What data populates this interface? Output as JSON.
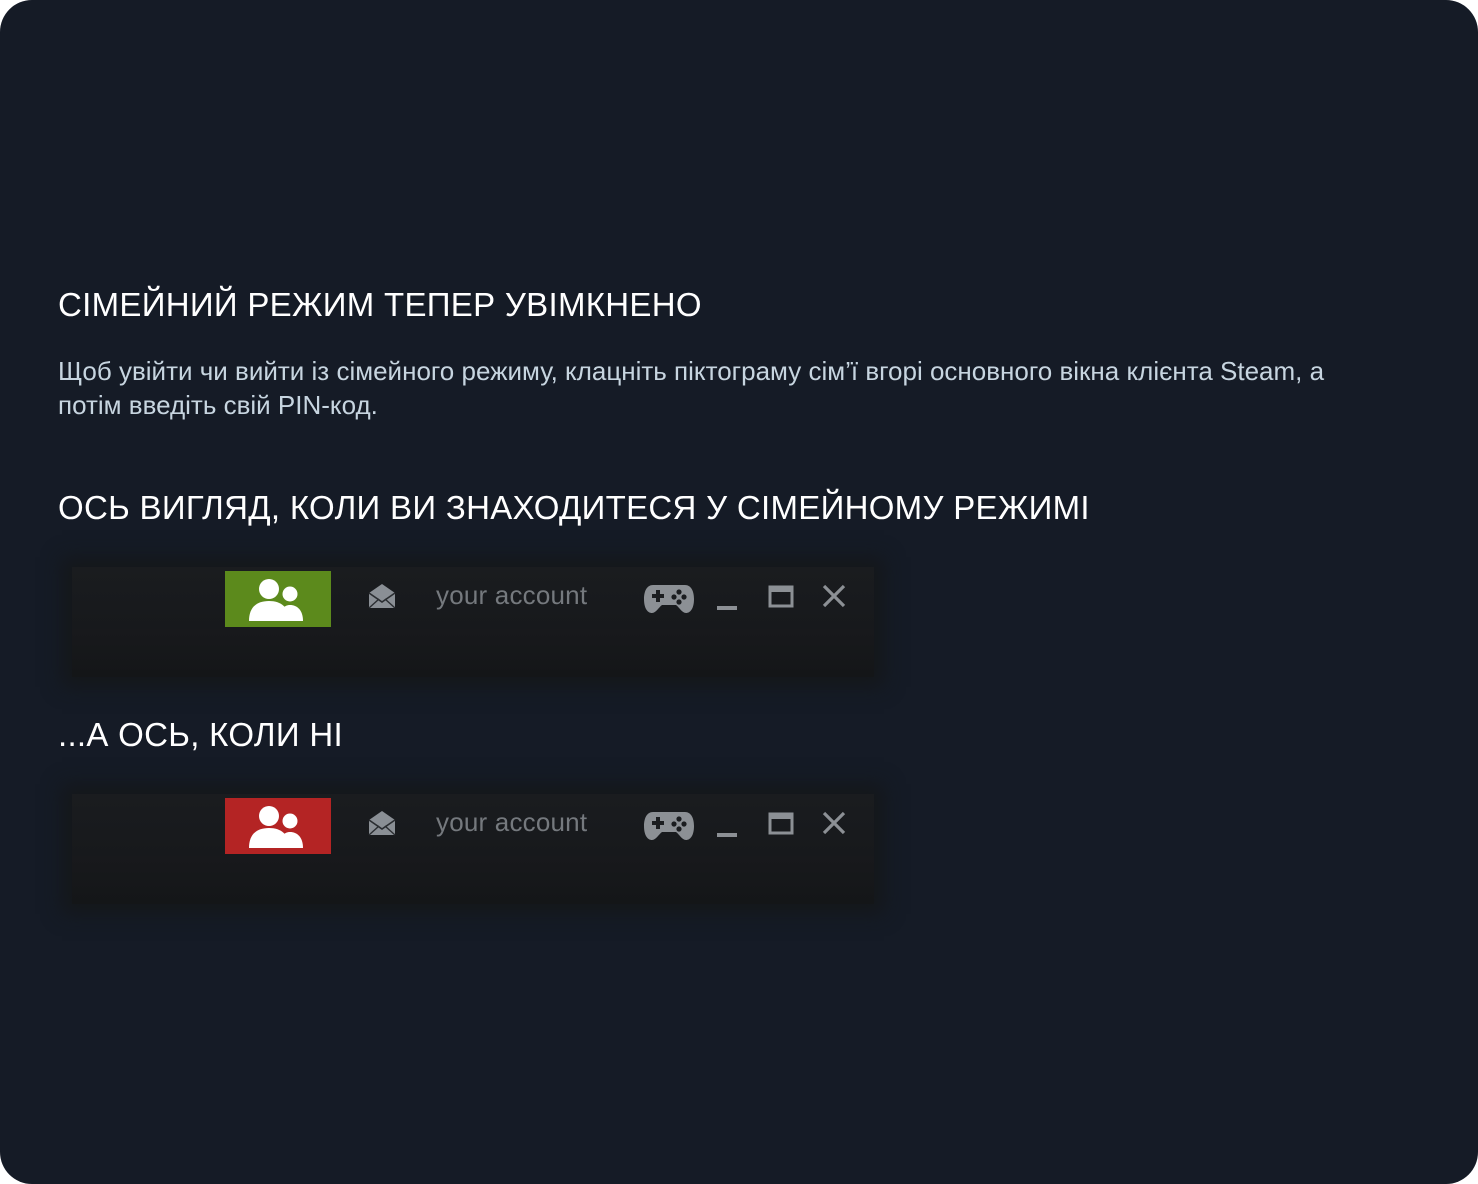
{
  "title": "СІМЕЙНИЙ РЕЖИМ ТЕПЕР УВІМКНЕНО",
  "description": "Щоб увійти чи вийти із сімейного режиму, клацніть піктограму сім’ї вгорі основного вікна клієнта Steam, а потім введіть свій PIN-код.",
  "section_in_family": "ОСЬ ВИГЛЯД, КОЛИ ВИ ЗНАХОДИТЕСЯ У СІМЕЙНОМУ РЕЖИМІ",
  "section_not_family": "...А ОСЬ, КОЛИ НІ",
  "example_in": {
    "family_button_color": "#5c8a1c",
    "family_icon": "family-icon",
    "mail_icon": "envelope-icon",
    "account_label": "your account",
    "controller_icon": "gamepad-icon",
    "window_controls": [
      "minimize-icon",
      "maximize-icon",
      "close-icon"
    ]
  },
  "example_out": {
    "family_button_color": "#b42424",
    "family_icon": "family-icon",
    "mail_icon": "envelope-icon",
    "account_label": "your account",
    "controller_icon": "gamepad-icon",
    "window_controls": [
      "minimize-icon",
      "maximize-icon",
      "close-icon"
    ]
  },
  "colors": {
    "background": "#151b26",
    "heading": "#ffffff",
    "body_text": "#c7d5e0",
    "muted_text": "#75797e"
  }
}
